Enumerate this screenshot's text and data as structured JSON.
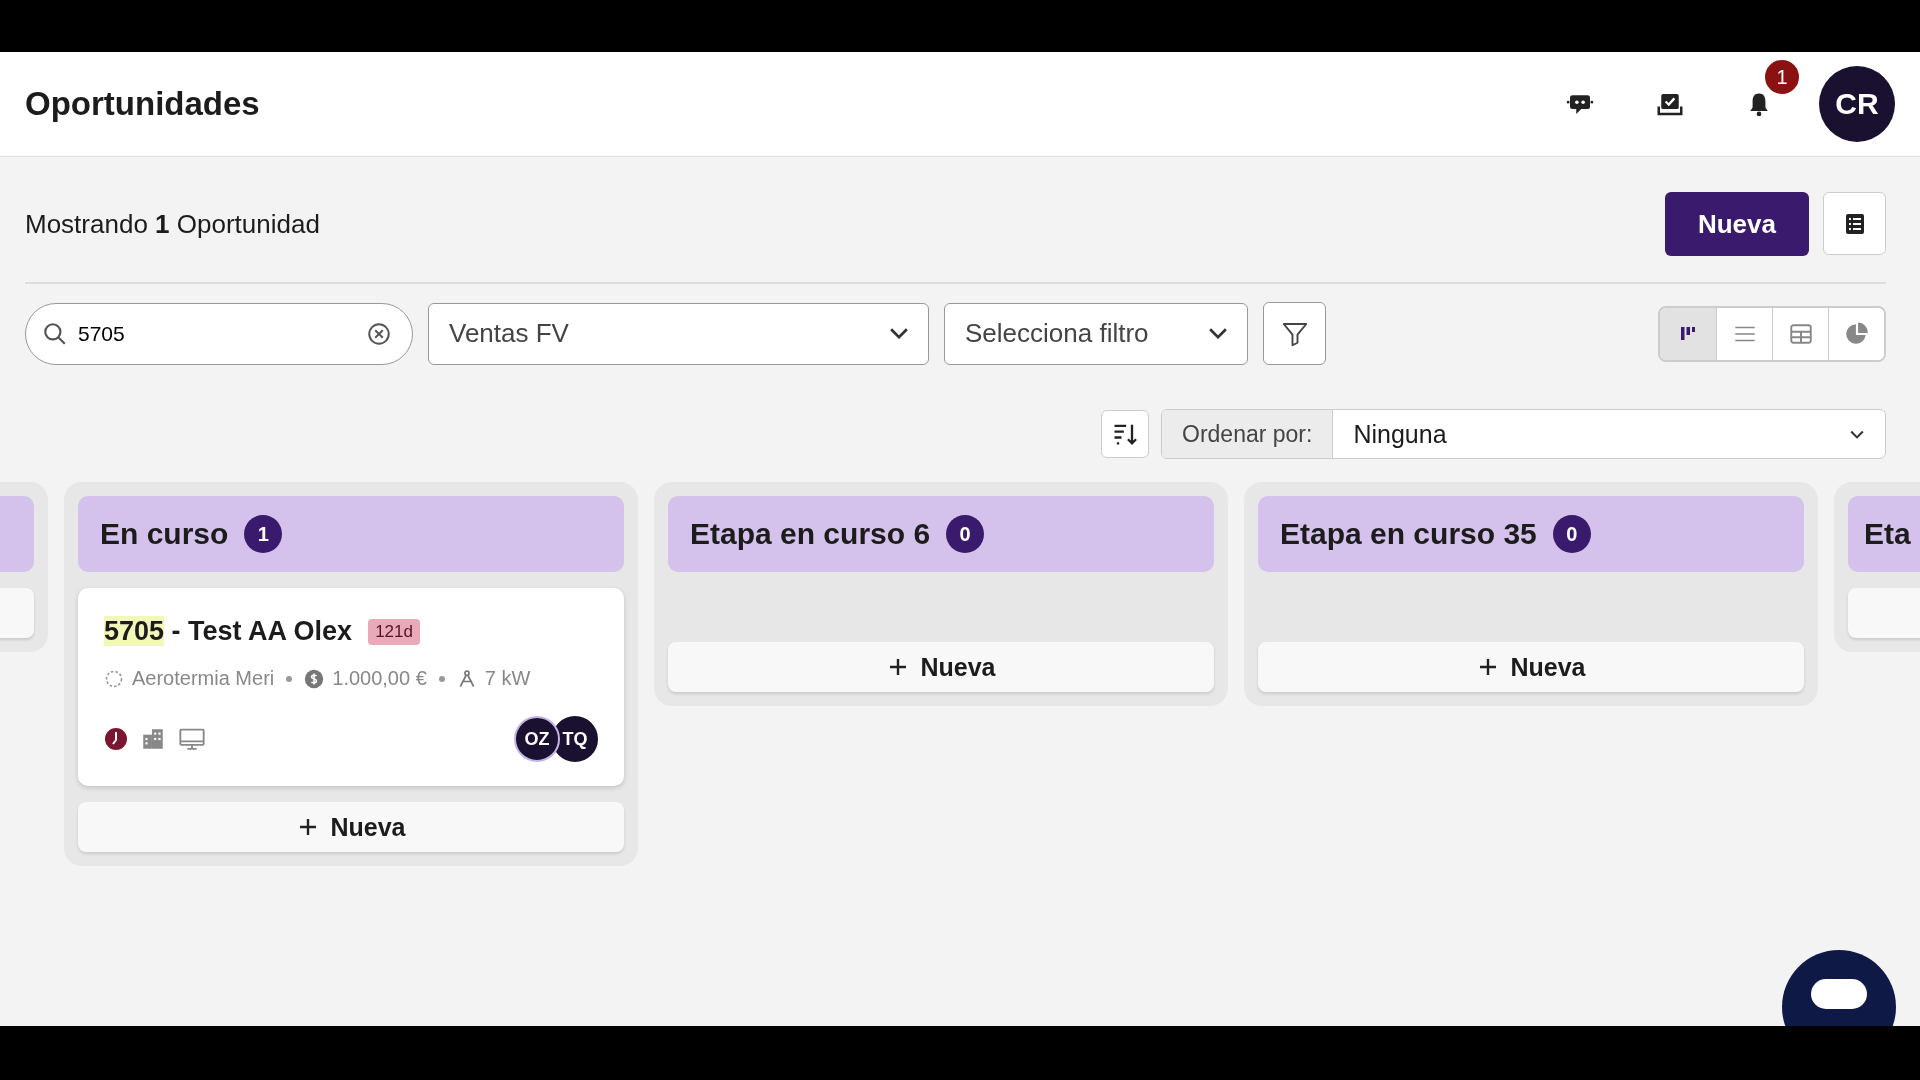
{
  "header": {
    "title": "Oportunidades",
    "notification_count": "1",
    "avatar": "CR"
  },
  "summary": {
    "prefix": "Mostrando",
    "count": "1",
    "suffix": "Oportunidad"
  },
  "new_button": "Nueva",
  "search": {
    "value": "5705"
  },
  "pipeline_select": {
    "value": "Ventas FV"
  },
  "filter_select": {
    "prompt": "Selecciona filtro"
  },
  "views": [
    {
      "kind": "kanban",
      "selected": true
    },
    {
      "kind": "list",
      "selected": false
    },
    {
      "kind": "table",
      "selected": false
    },
    {
      "kind": "chart",
      "selected": false
    }
  ],
  "sort": {
    "label": "Ordenar por:",
    "value": "Ninguna"
  },
  "columns": [
    {
      "kind": "partial"
    },
    {
      "kind": "full",
      "title": "En curso",
      "count": "1",
      "add_label": "Nueva",
      "cards": [
        {
          "match": "5705",
          "title": "- Test AA Olex",
          "age": "121d",
          "product": "Aerotermia Meri",
          "amount": "1.000,00 €",
          "power": "7 kW",
          "assignees": [
            "OZ",
            "TQ"
          ]
        }
      ]
    },
    {
      "kind": "full",
      "title": "Etapa en curso 6",
      "count": "0",
      "add_label": "Nueva"
    },
    {
      "kind": "full",
      "title": "Etapa en curso 35",
      "count": "0",
      "add_label": "Nueva"
    },
    {
      "kind": "partial",
      "title": "Eta"
    }
  ]
}
